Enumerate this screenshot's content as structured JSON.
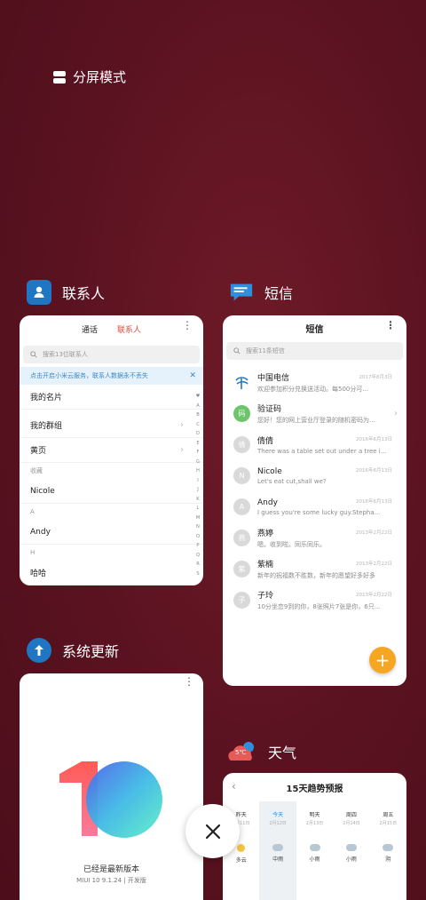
{
  "split_mode": {
    "label": "分屏模式"
  },
  "apps": {
    "contacts": {
      "label": "联系人",
      "accent": "#1f77c4"
    },
    "messages": {
      "label": "短信",
      "accent": "#1f77c4"
    },
    "updater": {
      "label": "系统更新",
      "accent": "#1f77c4"
    },
    "weather": {
      "label": "天气",
      "badge": "5℃",
      "accent": "#e85a55"
    }
  },
  "contacts_card": {
    "tabs": [
      "通话",
      "联系人"
    ],
    "active_tab": "联系人",
    "search_placeholder": "搜索13位联系人",
    "banner": "点击开启小米云服务，联系人数据永不丢失",
    "rows": {
      "my_card": "我的名片",
      "my_groups": "我的群组",
      "yellow_pages": "黄页",
      "favorites_header": "收藏",
      "nicole": "Nicole",
      "section_a": "A",
      "andy": "Andy",
      "section_h": "H",
      "haha": "哈哈"
    },
    "alphabet": [
      "♥",
      "A",
      "B",
      "C",
      "D",
      "E",
      "F",
      "G",
      "H",
      "I",
      "J",
      "K",
      "L",
      "M",
      "N",
      "O",
      "P",
      "Q",
      "R",
      "S"
    ]
  },
  "messages_card": {
    "title": "短信",
    "search_placeholder": "搜索11条短信",
    "threads": [
      {
        "avatar": "",
        "name": "中国电信",
        "snippet": "欢迎参加积分兑换送活动。每500分可...",
        "date": "2017年8月3日"
      },
      {
        "avatar": "码",
        "name": "验证码",
        "snippet": "您好！您的网上营业厅登录的随机密码为...",
        "date": ""
      },
      {
        "avatar": "倩",
        "name": "倩倩",
        "snippet": "There was a table set out under a tree i...",
        "date": "2016年6月13日"
      },
      {
        "avatar": "N",
        "name": "Nicole",
        "snippet": "Let's eat cut,shall we?",
        "date": "2016年6月13日"
      },
      {
        "avatar": "A",
        "name": "Andy",
        "snippet": "I guess you're some lucky guy.Stepha...",
        "date": "2016年6月13日"
      },
      {
        "avatar": "燕",
        "name": "燕婷",
        "snippet": "嗯。收到啦。同乐同乐。",
        "date": "2013年2月22日"
      },
      {
        "avatar": "紫",
        "name": "紫楠",
        "snippet": "新年的祝福数不胜数，新年的愿望好多好多",
        "date": "2013年2月22日"
      },
      {
        "avatar": "子",
        "name": "子玲",
        "snippet": "10分坐恋9到的你，8张照片7张是你，6只...",
        "date": "2013年2月22日"
      }
    ],
    "fab": "+"
  },
  "updater_card": {
    "title": "已经是最新版本",
    "version": "MIUI 10 9.1.24 | 开发版"
  },
  "weather_card": {
    "title": "15天趋势预报",
    "days": [
      {
        "day": "昨天",
        "date": "2月11日",
        "cond": "多云",
        "icon": "sun"
      },
      {
        "day": "今天",
        "date": "2月12日",
        "cond": "中雨",
        "icon": "cloud",
        "today": true
      },
      {
        "day": "明天",
        "date": "2月13日",
        "cond": "小雨",
        "icon": "cloud"
      },
      {
        "day": "周四",
        "date": "2月14日",
        "cond": "小雨",
        "icon": "cloud"
      },
      {
        "day": "周五",
        "date": "2月15日",
        "cond": "阴",
        "icon": "cloud"
      }
    ]
  },
  "close_button": {
    "symbol": "✕"
  }
}
